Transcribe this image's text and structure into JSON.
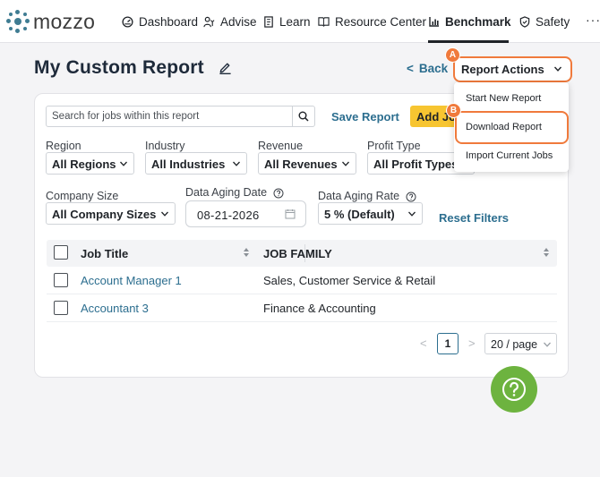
{
  "brand": {
    "name": "mozzo"
  },
  "nav": {
    "items": [
      {
        "label": "Dashboard",
        "icon": "dashboard-gauge-icon"
      },
      {
        "label": "Advise",
        "icon": "advise-people-icon"
      },
      {
        "label": "Learn",
        "icon": "learn-book-icon"
      },
      {
        "label": "Resource Center",
        "icon": "resource-center-icon"
      },
      {
        "label": "Benchmark",
        "icon": "benchmark-chart-icon",
        "active": true
      },
      {
        "label": "Safety",
        "icon": "safety-shield-icon"
      }
    ],
    "more_label": "···"
  },
  "page": {
    "title": "My Custom Report",
    "back_label": "Back"
  },
  "report_actions": {
    "label": "Report Actions",
    "menu": [
      "Start New Report",
      "Download Report",
      "Import Current Jobs"
    ],
    "highlighted_item": "Download Report",
    "accent_color": "#f07a3c"
  },
  "callouts": {
    "a": "A",
    "b": "B"
  },
  "search": {
    "placeholder": "Search for jobs within this report"
  },
  "actions": {
    "save_report": "Save Report",
    "add_jobs": "Add Jobs"
  },
  "filters": {
    "region": {
      "label": "Region",
      "value": "All Regions"
    },
    "industry": {
      "label": "Industry",
      "value": "All Industries"
    },
    "revenue": {
      "label": "Revenue",
      "value": "All Revenues"
    },
    "profit_type": {
      "label": "Profit Type",
      "value": "All Profit Types"
    },
    "company_size": {
      "label": "Company Size",
      "value": "All Company Sizes"
    },
    "data_aging_date": {
      "label": "Data Aging Date",
      "value": "08-21-2026"
    },
    "data_aging_rate": {
      "label": "Data Aging Rate",
      "value": "5 % (Default)"
    },
    "reset_label": "Reset Filters"
  },
  "table": {
    "columns": [
      "Job Title",
      "JOB FAMILY"
    ],
    "rows": [
      {
        "title": "Account Manager 1",
        "family": "Sales, Customer Service & Retail"
      },
      {
        "title": "Accountant 3",
        "family": "Finance & Accounting"
      }
    ]
  },
  "pagination": {
    "prev": "<",
    "current": "1",
    "next": ">",
    "page_size": "20 / page"
  },
  "colors": {
    "link": "#2c6e8f",
    "add_button": "#f7c531",
    "help_button": "#6db33f"
  }
}
